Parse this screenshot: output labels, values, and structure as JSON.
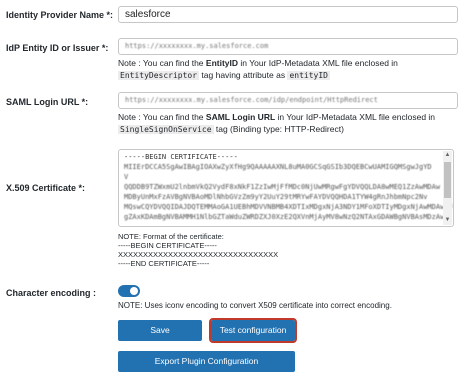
{
  "identity_provider": {
    "label": "Identity Provider Name *:",
    "value": "salesforce"
  },
  "idp_entity": {
    "label": "IdP Entity ID or Issuer *:",
    "value": "https://xxxxxxxx.my.salesforce.com",
    "note_prefix": "Note : You can find the ",
    "note_bold": "EntityID",
    "note_mid": " in Your IdP-Metadata XML file enclosed in ",
    "note_code1": "EntityDescriptor",
    "note_mid2": " tag having attribute as ",
    "note_code2": "entityID"
  },
  "saml_login": {
    "label": "SAML Login URL *:",
    "value": "https://xxxxxxxx.my.salesforce.com/idp/endpoint/HttpRedirect",
    "note_prefix": "Note : You can find the ",
    "note_bold": "SAML Login URL",
    "note_mid": " in Your IdP-Metadata XML file enclosed in ",
    "note_code": "SingleSignOnService",
    "note_suffix": " tag (Binding type: HTTP-Redirect)"
  },
  "certificate": {
    "label": "X.509 Certificate *:",
    "begin": "-----BEGIN CERTIFICATE-----",
    "lines": [
      "MIIErDCCA5SgAwIBAgIOAXwZyXfHg9QAAAAAXNL8uMA0GCSqGSIb3DQEBCwUAMIGQMSgwJgYD",
      "V",
      "QQDDB9TZWxmU2lnbmVkQ2VydF8xNkF1ZzIwMjFfMDc0NjUwMRgwFgYDVQQLDA8wMEQ1ZzAwMDAw",
      "MDByUnMxFzAVBgNVBAoMDlNhbGVzZm9yY2UuY29tMRYwFAYDVQQHDA1TYW4gRnJhbmNpc2Nv",
      "MQswCQYDVQQIDAJDQTEMMAoGA1UEBhMDVVNBMB4XDTIxMDgxNjA3NDY1MFoXDTIyMDgxNjAwMDAwMFow",
      "gZAxKDAmBgNVBAMMH1NlbGZTaWduZWRDZXJ0XzE2QXVnMjAyMV8wNzQ2NTAxGDAWBgNVBAsMDzAw"
    ],
    "format_title": "NOTE: Format of the certificate:",
    "format_begin": "-----BEGIN CERTIFICATE-----",
    "format_body": "XXXXXXXXXXXXXXXXXXXXXXXXXXXXXXXX",
    "format_end": "-----END CERTIFICATE-----"
  },
  "encoding": {
    "label": "Character encoding :",
    "enabled": true,
    "note": "NOTE: Uses iconv encoding to convert X509 certificate into correct encoding."
  },
  "buttons": {
    "save": "Save",
    "test": "Test configuration",
    "export": "Export Plugin Configuration"
  },
  "colors": {
    "primary": "#2271b1",
    "highlight": "#c0392b"
  }
}
